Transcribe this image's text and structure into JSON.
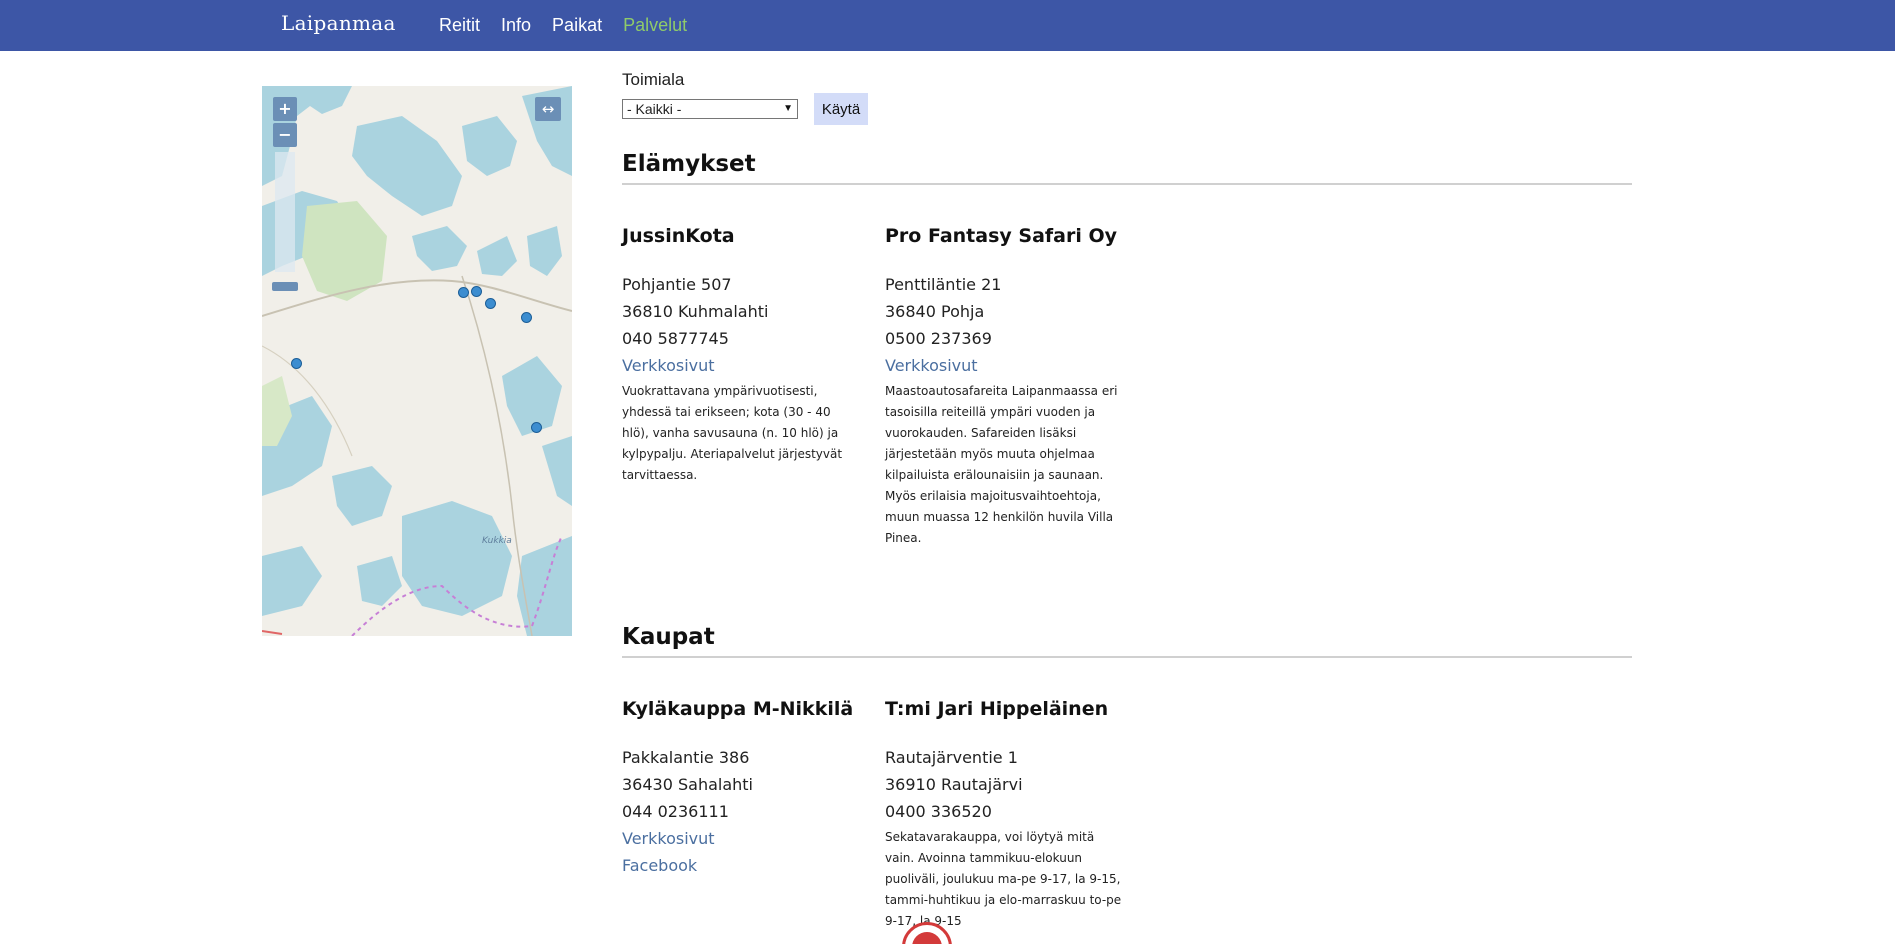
{
  "header": {
    "brand": "Laipanmaa",
    "nav": [
      {
        "label": "Reitit",
        "active": false
      },
      {
        "label": "Info",
        "active": false
      },
      {
        "label": "Paikat",
        "active": false
      },
      {
        "label": "Palvelut",
        "active": true
      }
    ],
    "colors": {
      "bar": "#3d56a6",
      "active": "#8fcb6a"
    }
  },
  "map": {
    "zoom_in": "+",
    "zoom_out": "−",
    "expand": "↔",
    "place_label": "Kukkia",
    "marker_count": 7
  },
  "filter": {
    "label": "Toimiala",
    "selected": "- Kaikki -",
    "apply_label": "Käytä"
  },
  "sections": [
    {
      "title": "Elämykset",
      "items": [
        {
          "name": "JussinKota",
          "street": "Pohjantie 507",
          "postal": "36810 Kuhmalahti",
          "phone": "040 5877745",
          "links": [
            "Verkkosivut"
          ],
          "description": "Vuokrattavana ympärivuotisesti, yhdessä tai erikseen; kota (30 - 40 hlö), vanha savusauna (n. 10 hlö) ja kylpypalju. Ateriapalvelut järjestyvät tarvittaessa."
        },
        {
          "name": "Pro Fantasy Safari Oy",
          "street": "Penttiläntie 21",
          "postal": "36840 Pohja",
          "phone": "0500 237369",
          "links": [
            "Verkkosivut"
          ],
          "description": "Maastoautosafareita Laipanmaassa eri tasoisilla reiteillä ympäri vuoden ja vuorokauden. Safareiden lisäksi järjestetään myös muuta ohjelmaa kilpailuista erälounaisiin ja saunaan. Myös erilaisia majoitusvaihtoehtoja, muun muassa 12 henkilön huvila Villa Pinea."
        }
      ]
    },
    {
      "title": "Kaupat",
      "items": [
        {
          "name": "Kyläkauppa M-Nikkilä",
          "street": "Pakkalantie 386",
          "postal": "36430 Sahalahti",
          "phone": "044 0236111",
          "links": [
            "Verkkosivut",
            "Facebook"
          ],
          "description": ""
        },
        {
          "name": "T:mi Jari Hippeläinen",
          "street": "Rautajärventie 1",
          "postal": "36910 Rautajärvi",
          "phone": "0400 336520",
          "links": [],
          "description": "Sekatavarakauppa, voi löytyä mitä vain. Avoinna tammikuu-elokuun puoliväli, joulukuu ma-pe 9-17, la 9-15, tammi-huhtikuu ja elo-marraskuu to-pe 9-17, la 9-15"
        }
      ]
    }
  ]
}
